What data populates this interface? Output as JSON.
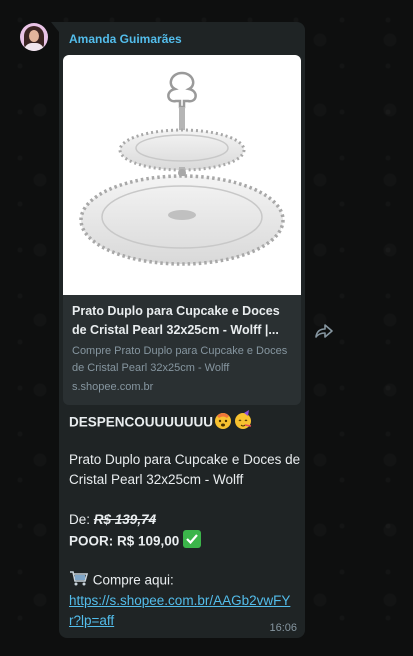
{
  "sender": {
    "name": "Amanda Guimarães"
  },
  "link_preview": {
    "title": "Prato Duplo para Cupcake e Doces de Cristal Pearl 32x25cm - Wolff |...",
    "description": "Compre Prato Duplo para Cupcake e Doces de Cristal Pearl 32x25cm - Wolff",
    "domain": "s.shopee.com.br"
  },
  "message": {
    "headline": "DESPENCOUUUUUUU",
    "product": "Prato Duplo para Cupcake e Doces de Cristal Pearl 32x25cm - Wolff",
    "from_label": "De:",
    "old_price": "R$ 139,74",
    "now_label": "POOR: R$ 109,00",
    "cta": "Compre aqui:",
    "url": "https://s.shopee.com.br/AAGb2vwFYr?lp=aff",
    "time": "16:06"
  },
  "colors": {
    "sender_name": "#53bdeb",
    "bubble": "#1f2425",
    "link": "#53bdeb",
    "check": "#3bb54a"
  },
  "icons": {
    "avatar": "avatar",
    "forward": "forward-icon",
    "emoji_1": "exploding-head-emoji",
    "emoji_2": "partying-face-emoji",
    "check": "check-mark-button-emoji",
    "cart": "shopping-cart-emoji"
  }
}
